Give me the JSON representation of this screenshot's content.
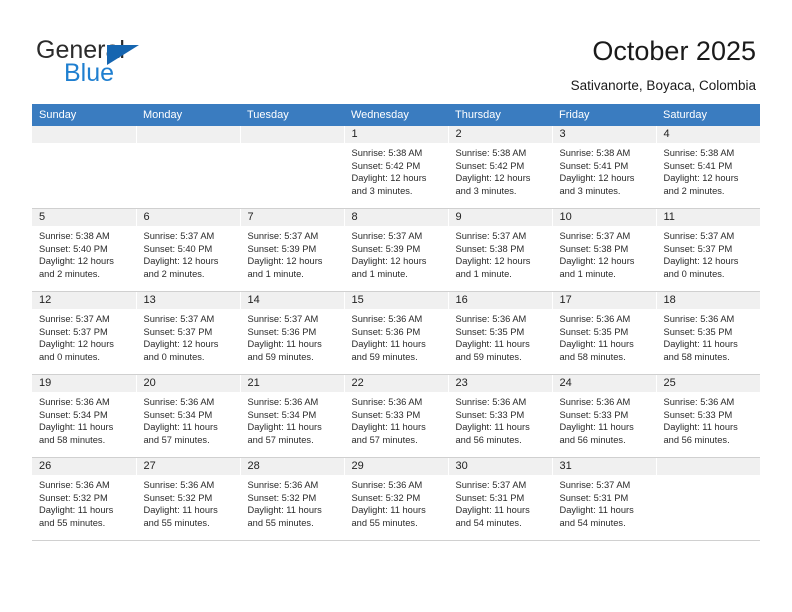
{
  "brand": {
    "name_top": "General",
    "name_bottom": "Blue",
    "triangle_color": "#1565b0",
    "blue_text_color": "#1f7fd0"
  },
  "header": {
    "title": "October 2025",
    "subtitle": "Sativanorte, Boyaca, Colombia",
    "header_bg": "#3a7cc0",
    "header_text_color": "#ffffff"
  },
  "weekday_headers": [
    "Sunday",
    "Monday",
    "Tuesday",
    "Wednesday",
    "Thursday",
    "Friday",
    "Saturday"
  ],
  "labels": {
    "sunrise_prefix": "Sunrise:",
    "sunset_prefix": "Sunset:",
    "daylight_prefix": "Daylight:"
  },
  "weeks": [
    [
      {
        "day": "",
        "sunrise": "",
        "sunset": "",
        "daylight_line1": "",
        "daylight_line2": ""
      },
      {
        "day": "",
        "sunrise": "",
        "sunset": "",
        "daylight_line1": "",
        "daylight_line2": ""
      },
      {
        "day": "",
        "sunrise": "",
        "sunset": "",
        "daylight_line1": "",
        "daylight_line2": ""
      },
      {
        "day": "1",
        "sunrise": "Sunrise: 5:38 AM",
        "sunset": "Sunset: 5:42 PM",
        "daylight_line1": "Daylight: 12 hours",
        "daylight_line2": "and 3 minutes."
      },
      {
        "day": "2",
        "sunrise": "Sunrise: 5:38 AM",
        "sunset": "Sunset: 5:42 PM",
        "daylight_line1": "Daylight: 12 hours",
        "daylight_line2": "and 3 minutes."
      },
      {
        "day": "3",
        "sunrise": "Sunrise: 5:38 AM",
        "sunset": "Sunset: 5:41 PM",
        "daylight_line1": "Daylight: 12 hours",
        "daylight_line2": "and 3 minutes."
      },
      {
        "day": "4",
        "sunrise": "Sunrise: 5:38 AM",
        "sunset": "Sunset: 5:41 PM",
        "daylight_line1": "Daylight: 12 hours",
        "daylight_line2": "and 2 minutes."
      }
    ],
    [
      {
        "day": "5",
        "sunrise": "Sunrise: 5:38 AM",
        "sunset": "Sunset: 5:40 PM",
        "daylight_line1": "Daylight: 12 hours",
        "daylight_line2": "and 2 minutes."
      },
      {
        "day": "6",
        "sunrise": "Sunrise: 5:37 AM",
        "sunset": "Sunset: 5:40 PM",
        "daylight_line1": "Daylight: 12 hours",
        "daylight_line2": "and 2 minutes."
      },
      {
        "day": "7",
        "sunrise": "Sunrise: 5:37 AM",
        "sunset": "Sunset: 5:39 PM",
        "daylight_line1": "Daylight: 12 hours",
        "daylight_line2": "and 1 minute."
      },
      {
        "day": "8",
        "sunrise": "Sunrise: 5:37 AM",
        "sunset": "Sunset: 5:39 PM",
        "daylight_line1": "Daylight: 12 hours",
        "daylight_line2": "and 1 minute."
      },
      {
        "day": "9",
        "sunrise": "Sunrise: 5:37 AM",
        "sunset": "Sunset: 5:38 PM",
        "daylight_line1": "Daylight: 12 hours",
        "daylight_line2": "and 1 minute."
      },
      {
        "day": "10",
        "sunrise": "Sunrise: 5:37 AM",
        "sunset": "Sunset: 5:38 PM",
        "daylight_line1": "Daylight: 12 hours",
        "daylight_line2": "and 1 minute."
      },
      {
        "day": "11",
        "sunrise": "Sunrise: 5:37 AM",
        "sunset": "Sunset: 5:37 PM",
        "daylight_line1": "Daylight: 12 hours",
        "daylight_line2": "and 0 minutes."
      }
    ],
    [
      {
        "day": "12",
        "sunrise": "Sunrise: 5:37 AM",
        "sunset": "Sunset: 5:37 PM",
        "daylight_line1": "Daylight: 12 hours",
        "daylight_line2": "and 0 minutes."
      },
      {
        "day": "13",
        "sunrise": "Sunrise: 5:37 AM",
        "sunset": "Sunset: 5:37 PM",
        "daylight_line1": "Daylight: 12 hours",
        "daylight_line2": "and 0 minutes."
      },
      {
        "day": "14",
        "sunrise": "Sunrise: 5:37 AM",
        "sunset": "Sunset: 5:36 PM",
        "daylight_line1": "Daylight: 11 hours",
        "daylight_line2": "and 59 minutes."
      },
      {
        "day": "15",
        "sunrise": "Sunrise: 5:36 AM",
        "sunset": "Sunset: 5:36 PM",
        "daylight_line1": "Daylight: 11 hours",
        "daylight_line2": "and 59 minutes."
      },
      {
        "day": "16",
        "sunrise": "Sunrise: 5:36 AM",
        "sunset": "Sunset: 5:35 PM",
        "daylight_line1": "Daylight: 11 hours",
        "daylight_line2": "and 59 minutes."
      },
      {
        "day": "17",
        "sunrise": "Sunrise: 5:36 AM",
        "sunset": "Sunset: 5:35 PM",
        "daylight_line1": "Daylight: 11 hours",
        "daylight_line2": "and 58 minutes."
      },
      {
        "day": "18",
        "sunrise": "Sunrise: 5:36 AM",
        "sunset": "Sunset: 5:35 PM",
        "daylight_line1": "Daylight: 11 hours",
        "daylight_line2": "and 58 minutes."
      }
    ],
    [
      {
        "day": "19",
        "sunrise": "Sunrise: 5:36 AM",
        "sunset": "Sunset: 5:34 PM",
        "daylight_line1": "Daylight: 11 hours",
        "daylight_line2": "and 58 minutes."
      },
      {
        "day": "20",
        "sunrise": "Sunrise: 5:36 AM",
        "sunset": "Sunset: 5:34 PM",
        "daylight_line1": "Daylight: 11 hours",
        "daylight_line2": "and 57 minutes."
      },
      {
        "day": "21",
        "sunrise": "Sunrise: 5:36 AM",
        "sunset": "Sunset: 5:34 PM",
        "daylight_line1": "Daylight: 11 hours",
        "daylight_line2": "and 57 minutes."
      },
      {
        "day": "22",
        "sunrise": "Sunrise: 5:36 AM",
        "sunset": "Sunset: 5:33 PM",
        "daylight_line1": "Daylight: 11 hours",
        "daylight_line2": "and 57 minutes."
      },
      {
        "day": "23",
        "sunrise": "Sunrise: 5:36 AM",
        "sunset": "Sunset: 5:33 PM",
        "daylight_line1": "Daylight: 11 hours",
        "daylight_line2": "and 56 minutes."
      },
      {
        "day": "24",
        "sunrise": "Sunrise: 5:36 AM",
        "sunset": "Sunset: 5:33 PM",
        "daylight_line1": "Daylight: 11 hours",
        "daylight_line2": "and 56 minutes."
      },
      {
        "day": "25",
        "sunrise": "Sunrise: 5:36 AM",
        "sunset": "Sunset: 5:33 PM",
        "daylight_line1": "Daylight: 11 hours",
        "daylight_line2": "and 56 minutes."
      }
    ],
    [
      {
        "day": "26",
        "sunrise": "Sunrise: 5:36 AM",
        "sunset": "Sunset: 5:32 PM",
        "daylight_line1": "Daylight: 11 hours",
        "daylight_line2": "and 55 minutes."
      },
      {
        "day": "27",
        "sunrise": "Sunrise: 5:36 AM",
        "sunset": "Sunset: 5:32 PM",
        "daylight_line1": "Daylight: 11 hours",
        "daylight_line2": "and 55 minutes."
      },
      {
        "day": "28",
        "sunrise": "Sunrise: 5:36 AM",
        "sunset": "Sunset: 5:32 PM",
        "daylight_line1": "Daylight: 11 hours",
        "daylight_line2": "and 55 minutes."
      },
      {
        "day": "29",
        "sunrise": "Sunrise: 5:36 AM",
        "sunset": "Sunset: 5:32 PM",
        "daylight_line1": "Daylight: 11 hours",
        "daylight_line2": "and 55 minutes."
      },
      {
        "day": "30",
        "sunrise": "Sunrise: 5:37 AM",
        "sunset": "Sunset: 5:31 PM",
        "daylight_line1": "Daylight: 11 hours",
        "daylight_line2": "and 54 minutes."
      },
      {
        "day": "31",
        "sunrise": "Sunrise: 5:37 AM",
        "sunset": "Sunset: 5:31 PM",
        "daylight_line1": "Daylight: 11 hours",
        "daylight_line2": "and 54 minutes."
      },
      {
        "day": "",
        "sunrise": "",
        "sunset": "",
        "daylight_line1": "",
        "daylight_line2": ""
      }
    ]
  ]
}
